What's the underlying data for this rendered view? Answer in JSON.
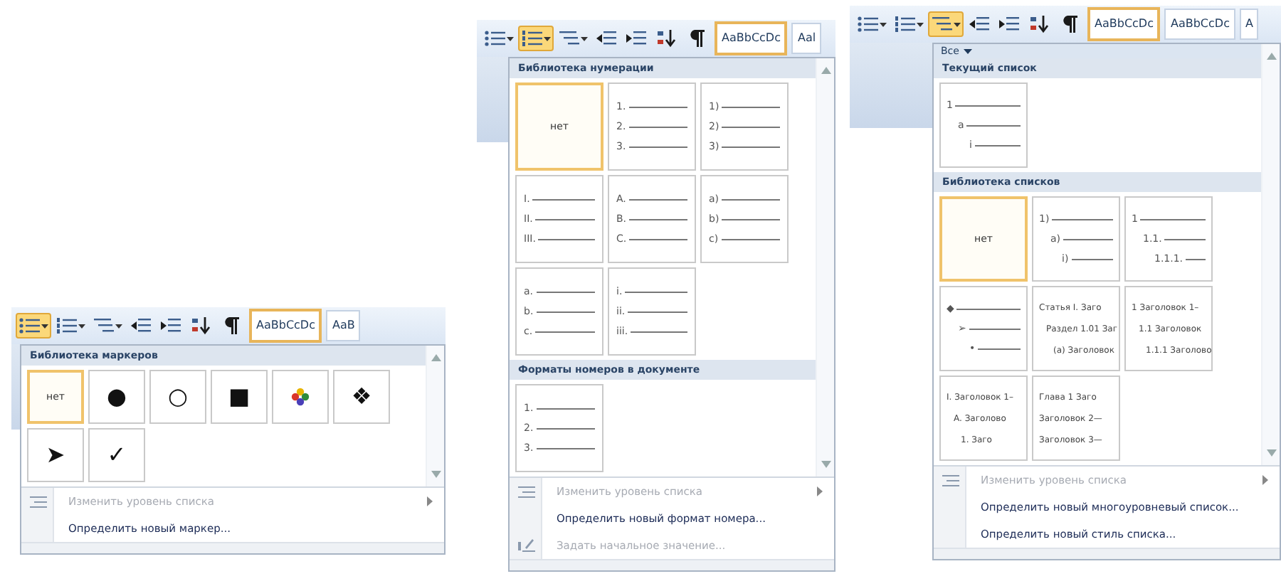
{
  "panels": [
    {
      "kind": "bullets",
      "toolbar": {
        "buttons": [
          {
            "kind": "bullets",
            "active": true
          },
          {
            "kind": "numbering",
            "active": false
          },
          {
            "kind": "multilevel",
            "active": false
          },
          {
            "kind": "outdent",
            "active": false
          },
          {
            "kind": "indent",
            "active": false
          },
          {
            "kind": "sort",
            "active": false
          },
          {
            "kind": "pilcrow",
            "active": false
          }
        ],
        "styles": [
          "AaBbCcDc",
          "AaB"
        ]
      },
      "sections": [
        {
          "title": "Библиотека маркеров",
          "cells": [
            {
              "kind": "none",
              "label": "нет",
              "selected": true
            },
            {
              "kind": "glyph",
              "label": "●",
              "selected": false
            },
            {
              "kind": "glyph",
              "label": "○",
              "selected": false
            },
            {
              "kind": "glyph",
              "label": "■",
              "selected": false
            },
            {
              "kind": "flower",
              "selected": false
            },
            {
              "kind": "glyph",
              "label": "❖",
              "selected": false
            },
            {
              "kind": "glyph",
              "label": "➤",
              "selected": false
            },
            {
              "kind": "glyph",
              "label": "✓",
              "selected": false
            }
          ]
        }
      ],
      "menu": [
        {
          "kind": "level",
          "label": "Изменить уровень списка",
          "disabled": true
        },
        {
          "kind": "plain",
          "label": "Определить новый маркер...",
          "disabled": false
        }
      ]
    },
    {
      "kind": "numbering",
      "toolbar": {
        "buttons": [
          {
            "kind": "bullets",
            "active": false
          },
          {
            "kind": "numbering",
            "active": true
          },
          {
            "kind": "multilevel",
            "active": false
          },
          {
            "kind": "outdent",
            "active": false
          },
          {
            "kind": "indent",
            "active": false
          },
          {
            "kind": "sort",
            "active": false
          },
          {
            "kind": "pilcrow",
            "active": false
          }
        ],
        "styles": [
          "AaBbCcDc",
          "Aal"
        ]
      },
      "sections": [
        {
          "title": "Библиотека нумерации",
          "cells": [
            {
              "kind": "none",
              "label": "нет",
              "selected": true
            },
            {
              "kind": "list",
              "lines": [
                "1.",
                "2.",
                "3."
              ],
              "selected": false
            },
            {
              "kind": "list",
              "lines": [
                "1)",
                "2)",
                "3)"
              ],
              "selected": false
            },
            {
              "kind": "list",
              "lines": [
                "I.",
                "II.",
                "III."
              ],
              "selected": false
            },
            {
              "kind": "list",
              "lines": [
                "A.",
                "B.",
                "C."
              ],
              "selected": false
            },
            {
              "kind": "list",
              "lines": [
                "a)",
                "b)",
                "c)"
              ],
              "selected": false
            },
            {
              "kind": "list",
              "lines": [
                "a.",
                "b.",
                "c."
              ],
              "selected": false
            },
            {
              "kind": "list",
              "lines": [
                "i.",
                "ii.",
                "iii."
              ],
              "selected": false
            }
          ]
        },
        {
          "title": "Форматы номеров в документе",
          "cells": [
            {
              "kind": "list",
              "lines": [
                "1.",
                "2.",
                "3."
              ],
              "selected": false
            }
          ]
        }
      ],
      "menu": [
        {
          "kind": "level",
          "label": "Изменить уровень списка",
          "disabled": true
        },
        {
          "kind": "plain",
          "label": "Определить новый формат номера...",
          "disabled": false
        },
        {
          "kind": "start",
          "label": "Задать начальное значение...",
          "disabled": true
        }
      ]
    },
    {
      "kind": "multilevel",
      "toolbar": {
        "buttons": [
          {
            "kind": "bullets",
            "active": false
          },
          {
            "kind": "numbering",
            "active": false
          },
          {
            "kind": "multilevel",
            "active": true
          },
          {
            "kind": "outdent",
            "active": false
          },
          {
            "kind": "indent",
            "active": false
          },
          {
            "kind": "sort",
            "active": false
          },
          {
            "kind": "pilcrow",
            "active": false
          }
        ],
        "styles": [
          "AaBbCcDc",
          "AaBbCcDc",
          "A"
        ]
      },
      "filter": {
        "label": "Все"
      },
      "sections": [
        {
          "title": "Текущий список",
          "cells": [
            {
              "kind": "outline",
              "lines": [
                "1",
                "a",
                "i"
              ],
              "selected": false
            }
          ]
        },
        {
          "title": "Библиотека списков",
          "cells": [
            {
              "kind": "none",
              "label": "нет",
              "selected": true
            },
            {
              "kind": "outline",
              "lines": [
                "1)",
                "a)",
                "i)"
              ],
              "selected": false
            },
            {
              "kind": "outline",
              "lines": [
                "1",
                "1.1.",
                "1.1.1."
              ],
              "selected": false
            },
            {
              "kind": "outline",
              "lines": [
                "◆",
                "➢",
                "•"
              ],
              "selected": false
            },
            {
              "kind": "headings",
              "lines": [
                "Статья I. Заго",
                "Раздел 1.01 Заг",
                "(a) Заголовок"
              ],
              "selected": false
            },
            {
              "kind": "headings",
              "lines": [
                "1 Заголовок 1–",
                "1.1 Заголовок",
                "1.1.1 Заголово"
              ],
              "selected": false
            },
            {
              "kind": "headings",
              "lines": [
                "I. Заголовок 1–",
                "A. Заголово",
                "1. Заго"
              ],
              "selected": false
            },
            {
              "kind": "flat",
              "lines": [
                "Глава 1 Заго",
                "Заголовок 2—",
                "Заголовок 3—"
              ],
              "selected": false
            }
          ]
        }
      ],
      "menu": [
        {
          "kind": "level",
          "label": "Изменить уровень списка",
          "disabled": true
        },
        {
          "kind": "plain",
          "label": "Определить новый многоуровневый список...",
          "disabled": false
        },
        {
          "kind": "plain",
          "label": "Определить новый стиль списка...",
          "disabled": false
        }
      ]
    }
  ]
}
